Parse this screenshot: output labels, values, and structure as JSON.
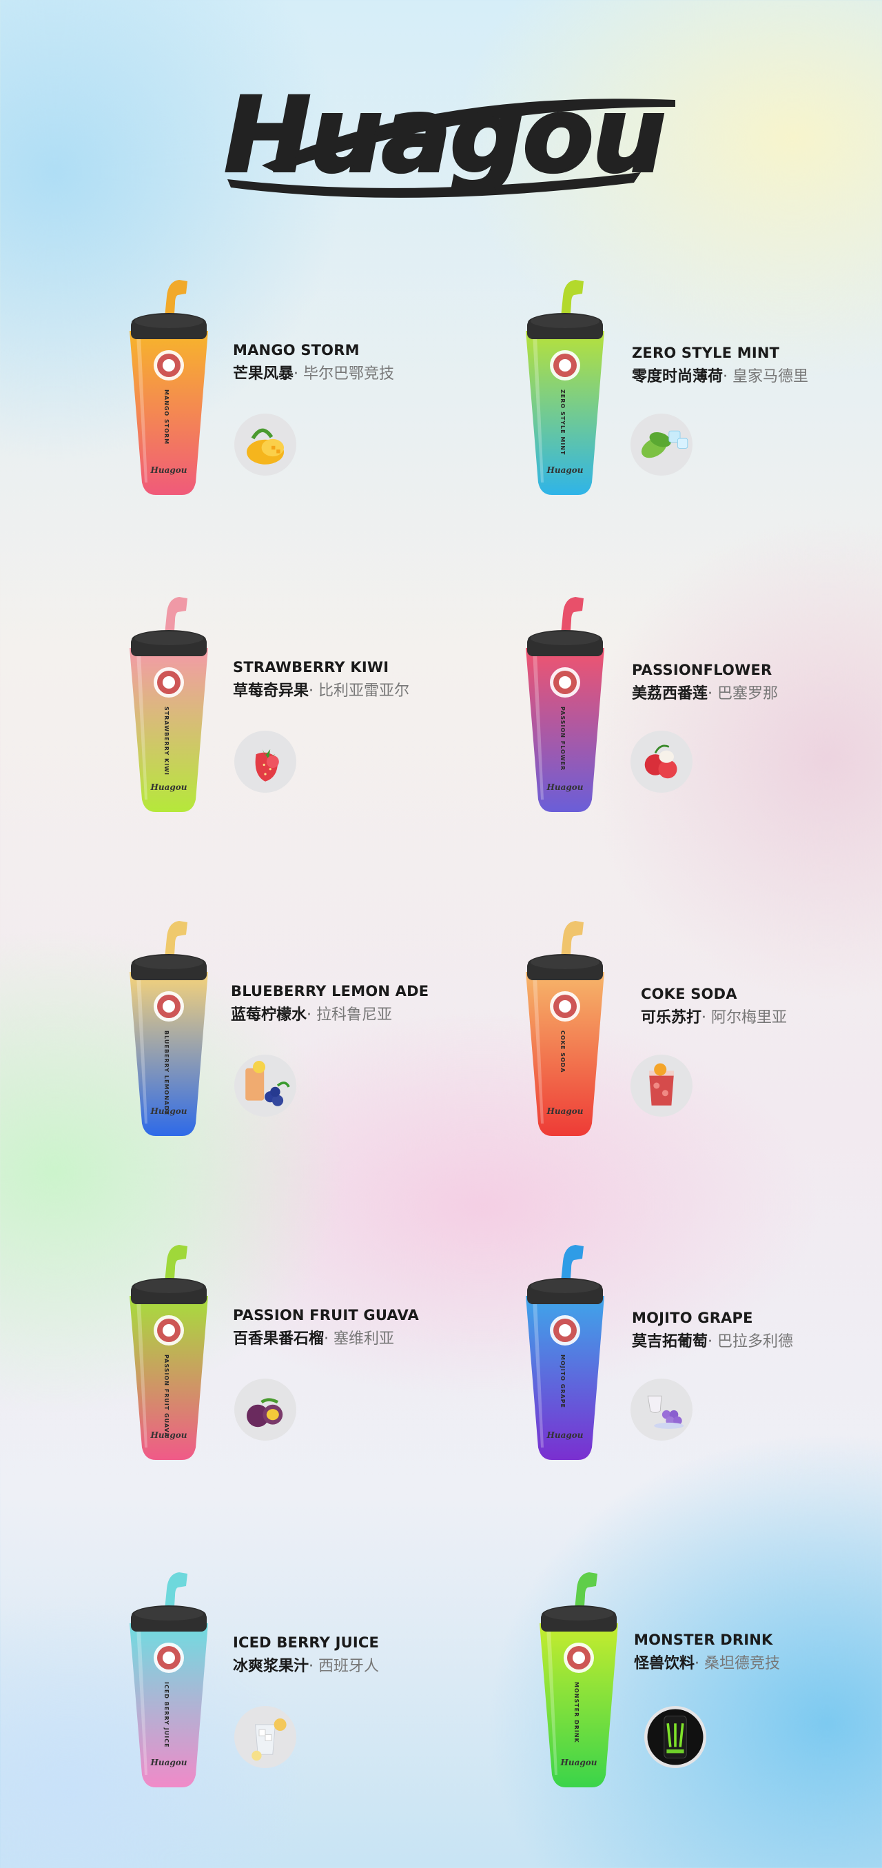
{
  "brand": {
    "logo_text": "Huagou"
  },
  "products": [
    {
      "name": "MANGO STORM",
      "cn": "芒果风暴",
      "sep": "·",
      "club": "毕尔巴鄂竞技",
      "can_label": "MANGO STORM",
      "can_brand": "Huagou",
      "icon": "mango-icon",
      "colors": {
        "top": "#f7b52b",
        "bottom": "#f05a7a",
        "straw": "#f1a92a"
      }
    },
    {
      "name": "ZERO STYLE MINT",
      "cn": "零度时尚薄荷",
      "sep": "·",
      "club": "皇家马德里",
      "can_label": "ZERO STYLE MINT",
      "can_brand": "Huagou",
      "icon": "mint-ice-icon",
      "colors": {
        "top": "#b7e13a",
        "bottom": "#2fb4e8",
        "straw": "#b3d92b"
      }
    },
    {
      "name": "STRAWBERRY KIWI",
      "cn": "草莓奇异果",
      "sep": "·",
      "club": "比利亚雷亚尔",
      "can_label": "STRAWBERRY KIWI",
      "can_brand": "Huagou",
      "icon": "strawberry-icon",
      "colors": {
        "top": "#f39aa8",
        "bottom": "#b5e83a",
        "straw": "#f099a6"
      }
    },
    {
      "name": "PASSIONFLOWER",
      "cn": "美荔西番莲",
      "sep": "·",
      "club": "巴塞罗那",
      "can_label": "PASSION FLOWER",
      "can_brand": "Huagou",
      "icon": "lychee-icon",
      "colors": {
        "top": "#f0546e",
        "bottom": "#6a5ed8",
        "straw": "#e8506a"
      }
    },
    {
      "name": "BLUEBERRY LEMON ADE",
      "cn": "蓝莓柠檬水",
      "sep": "·",
      "club": "拉科鲁尼亚",
      "can_label": "BLUEBERRY LEMONADE",
      "can_brand": "Huagou",
      "icon": "blueberry-lemon-icon",
      "colors": {
        "top": "#f6d37a",
        "bottom": "#2e6ae8",
        "straw": "#efc96c"
      }
    },
    {
      "name": "COKE SODA",
      "cn": "可乐苏打",
      "sep": "·",
      "club": "阿尔梅里亚",
      "can_label": "COKE SODA",
      "can_brand": "Huagou",
      "icon": "soda-glass-icon",
      "colors": {
        "top": "#f6b66a",
        "bottom": "#ee3b36",
        "straw": "#f0c46c"
      }
    },
    {
      "name": "PASSION FRUIT GUAVA",
      "cn": "百香果番石榴",
      "sep": "·",
      "club": "塞维利亚",
      "can_label": "PASSION FRUIT GUAVA",
      "can_brand": "Huagou",
      "icon": "passion-fruit-icon",
      "colors": {
        "top": "#a6de3c",
        "bottom": "#f05a88",
        "straw": "#9fd83a"
      }
    },
    {
      "name": "MOJITO GRAPE",
      "cn": "莫吉拓葡萄",
      "sep": "·",
      "club": "巴拉多利德",
      "can_label": "MOJITO GRAPE",
      "can_brand": "Huagou",
      "icon": "grape-icon",
      "colors": {
        "top": "#3fa6ea",
        "bottom": "#7a2fd0",
        "straw": "#2f9ce6"
      }
    },
    {
      "name": "ICED BERRY JUICE",
      "cn": "冰爽浆果汁",
      "sep": "·",
      "club": "西班牙人",
      "can_label": "ICED BERRY JUICE",
      "can_brand": "Huagou",
      "icon": "iced-juice-icon",
      "colors": {
        "top": "#6fdce0",
        "bottom": "#f08ac8",
        "straw": "#6ed8dc"
      }
    },
    {
      "name": "MONSTER DRINK",
      "cn": "怪兽饮料",
      "sep": "·",
      "club": "桑坦德竞技",
      "can_label": "MONSTER DRINK",
      "can_brand": "Huagou",
      "icon": "energy-can-icon",
      "colors": {
        "top": "#c6ec2e",
        "bottom": "#3ad44a",
        "straw": "#5fce4a"
      }
    }
  ]
}
